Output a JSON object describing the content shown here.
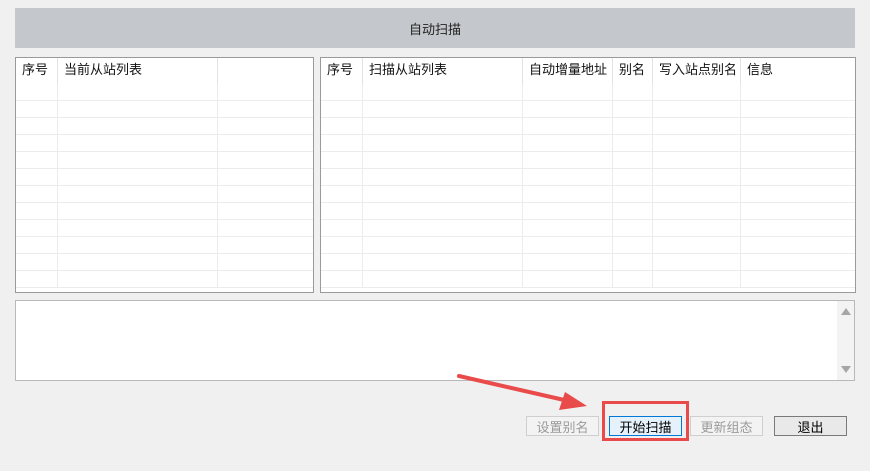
{
  "window": {
    "title": "自动扫描"
  },
  "current_slave_table": {
    "columns": [
      "序号",
      "当前从站列表",
      ""
    ],
    "rows": []
  },
  "scan_slave_table": {
    "columns": [
      "序号",
      "扫描从站列表",
      "自动增量地址",
      "别名",
      "写入站点别名",
      "信息"
    ],
    "rows": []
  },
  "log": {
    "text": ""
  },
  "buttons": {
    "set_alias": "设置别名",
    "start_scan": "开始扫描",
    "update_config": "更新组态",
    "exit": "退出"
  },
  "colors": {
    "annotation": "#e94a4a",
    "title_bar": "#c4c7cb",
    "focus": "#0078d7"
  }
}
